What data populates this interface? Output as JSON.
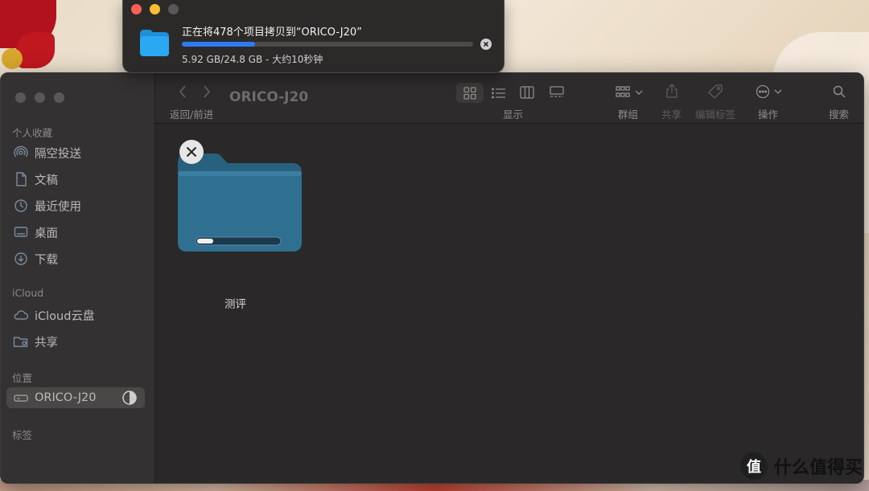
{
  "copy_dialog": {
    "title": "正在将478个项目拷贝到“ORICO-J20”",
    "status": "5.92 GB/24.8 GB - 大约10秒钟",
    "progress": 0.25,
    "icons": {
      "folder": "folder-icon",
      "cancel": "close-circle-icon"
    }
  },
  "finder": {
    "window_title": "ORICO-J20",
    "toolbar": {
      "back_forward_label": "返回/前进",
      "view_label": "显示",
      "group_label": "群组",
      "share_label": "共享",
      "edit_tags_label": "编辑标签",
      "action_label": "操作",
      "search_label": "搜索"
    },
    "sidebar": {
      "favorites_header": "个人收藏",
      "favorites": [
        {
          "label": "隔空投送",
          "icon": "airdrop-icon"
        },
        {
          "label": "文稿",
          "icon": "document-icon"
        },
        {
          "label": "最近使用",
          "icon": "clock-icon"
        },
        {
          "label": "桌面",
          "icon": "desktop-icon"
        },
        {
          "label": "下载",
          "icon": "download-icon"
        }
      ],
      "icloud_header": "iCloud",
      "icloud": [
        {
          "label": "iCloud云盘",
          "icon": "cloud-icon"
        },
        {
          "label": "共享",
          "icon": "shared-folder-icon"
        }
      ],
      "locations_header": "位置",
      "locations": [
        {
          "label": "ORICO-J20",
          "icon": "drive-icon"
        }
      ],
      "tags_header": "标签"
    },
    "content": {
      "folder_name": "测评",
      "folder_progress": 0.2
    }
  },
  "watermark": {
    "badge": "值",
    "text": "什么值得买"
  },
  "colors": {
    "accent": "#2d7cf6",
    "window_bg": "#2a2828",
    "sidebar_bg": "#333131",
    "folder": "#2f6e8e"
  }
}
